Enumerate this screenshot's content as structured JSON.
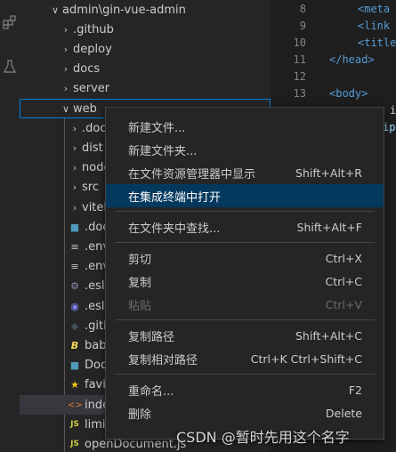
{
  "explorer": {
    "breadcrumb_row": {
      "label": "admin\\gin-vue-admin"
    },
    "folders": [
      {
        "label": ".github"
      },
      {
        "label": "deploy"
      },
      {
        "label": "docs"
      },
      {
        "label": "server"
      },
      {
        "label": "web"
      }
    ],
    "web_children": [
      {
        "label": ".dock",
        "icon": "folder-chevron"
      },
      {
        "label": "dist",
        "icon": "folder-chevron"
      },
      {
        "label": "node",
        "icon": "folder-chevron"
      },
      {
        "label": "src",
        "icon": "folder-chevron"
      },
      {
        "label": "viteP",
        "icon": "folder-chevron"
      },
      {
        "label": ".dock",
        "icon": "docker-icon"
      },
      {
        "label": ".env.",
        "icon": "lines-icon"
      },
      {
        "label": ".env.",
        "icon": "lines-icon"
      },
      {
        "label": ".eslin",
        "icon": "gear-icon"
      },
      {
        "label": ".eslin",
        "icon": "eslint-icon"
      },
      {
        "label": ".gitig",
        "icon": "git-icon"
      },
      {
        "label": "babe",
        "icon": "babel-icon"
      },
      {
        "label": "Dock",
        "icon": "docker-icon"
      },
      {
        "label": "favic",
        "icon": "star-icon"
      },
      {
        "label": "index",
        "icon": "html-icon"
      },
      {
        "label": "limit.",
        "icon": "js-icon"
      },
      {
        "label": "openDocument.js",
        "icon": "js-icon"
      }
    ]
  },
  "editor": {
    "lines": [
      {
        "num": "8",
        "text": "<meta"
      },
      {
        "num": "9",
        "text": "<link"
      },
      {
        "num": "10",
        "text": "<title"
      },
      {
        "num": "11",
        "text": "</head>"
      },
      {
        "num": "12",
        "text": ""
      },
      {
        "num": "13",
        "text": "<body>"
      }
    ],
    "partial_line_a": "i",
    "partial_line_b": "ip"
  },
  "context_menu": {
    "groups": [
      [
        {
          "label": "新建文件...",
          "key": ""
        },
        {
          "label": "新建文件夹...",
          "key": ""
        },
        {
          "label": "在文件资源管理器中显示",
          "key": "Shift+Alt+R"
        },
        {
          "label": "在集成终端中打开",
          "key": "",
          "active": true
        }
      ],
      [
        {
          "label": "在文件夹中查找...",
          "key": "Shift+Alt+F"
        }
      ],
      [
        {
          "label": "剪切",
          "key": "Ctrl+X"
        },
        {
          "label": "复制",
          "key": "Ctrl+C"
        },
        {
          "label": "粘贴",
          "key": "Ctrl+V",
          "disabled": true
        }
      ],
      [
        {
          "label": "复制路径",
          "key": "Shift+Alt+C"
        },
        {
          "label": "复制相对路径",
          "key": "Ctrl+K Ctrl+Shift+C"
        }
      ],
      [
        {
          "label": "重命名...",
          "key": "F2"
        },
        {
          "label": "删除",
          "key": "Delete"
        }
      ]
    ]
  },
  "watermark": "CSDN @暂时先用这个名字",
  "colors": {
    "accent": "#007fd4",
    "menu_active": "#04395e",
    "js": "#cbcb41",
    "html": "#e37933",
    "docker": "#519aba",
    "babel": "#f5da55",
    "eslint": "#8080f2"
  }
}
